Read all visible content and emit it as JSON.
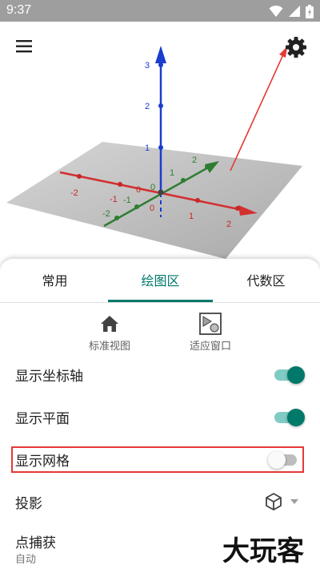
{
  "status_bar": {
    "time": "9:37"
  },
  "graphics": {
    "z_labels": [
      "3",
      "2",
      "1"
    ],
    "x_labels": [
      "-2",
      "-1",
      "0",
      "1",
      "2"
    ],
    "y_labels": [
      "-2",
      "-1",
      "0",
      "1",
      "2"
    ],
    "origin_label": "0",
    "colors": {
      "x_axis": "#d32f2f",
      "y_axis": "#2e7d32",
      "z_axis": "#1a3ccf",
      "plane": "#b0b0b0"
    }
  },
  "tabs": [
    {
      "label": "常用",
      "active": false
    },
    {
      "label": "绘图区",
      "active": true
    },
    {
      "label": "代数区",
      "active": false
    }
  ],
  "quick_actions": [
    {
      "label": "标准视图",
      "icon": "home-icon"
    },
    {
      "label": "适应窗口",
      "icon": "zoom-to-fit-icon"
    }
  ],
  "settings": [
    {
      "label": "显示坐标轴",
      "on": true
    },
    {
      "label": "显示平面",
      "on": true
    },
    {
      "label": "显示网格",
      "on": false
    }
  ],
  "projection": {
    "label": "投影",
    "icon": "cube-icon"
  },
  "point_capture": {
    "label": "点捕获",
    "value": "自动"
  },
  "watermark": "大玩客",
  "accent_color": "#00796b",
  "highlight_color": "#e53935"
}
